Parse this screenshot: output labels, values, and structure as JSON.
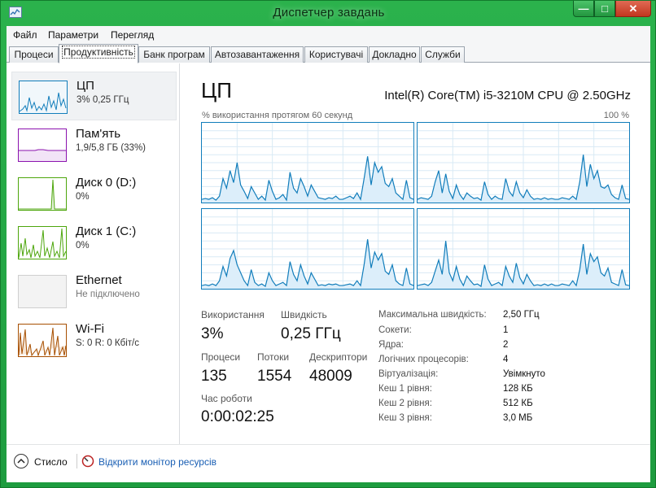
{
  "window": {
    "title": "Диспетчер завдань",
    "controls": {
      "minimize": "—",
      "maximize": "□",
      "close": "✕"
    }
  },
  "menu": [
    "Файл",
    "Параметри",
    "Перегляд"
  ],
  "tabs": [
    "Процеси",
    "Продуктивність",
    "Банк програм",
    "Автозавантаження",
    "Користувачі",
    "Докладно",
    "Служби"
  ],
  "active_tab": "Продуктивність",
  "sidebar": {
    "items": [
      {
        "name": "ЦП",
        "sub": "3% 0,25 ГГц",
        "color": "#117dbb"
      },
      {
        "name": "Пам'ять",
        "sub": "1,9/5,8 ГБ (33%)",
        "color": "#8b12ae"
      },
      {
        "name": "Диск 0 (D:)",
        "sub": "0%",
        "color": "#4da60c"
      },
      {
        "name": "Диск 1 (C:)",
        "sub": "0%",
        "color": "#4da60c"
      },
      {
        "name": "Ethernet",
        "sub": "Не підключено",
        "color": "#a7a7a7"
      },
      {
        "name": "Wi-Fi",
        "sub": "S: 0 R: 0 Кбіт/с",
        "color": "#a74f01"
      }
    ]
  },
  "cpu": {
    "title": "ЦП",
    "model": "Intel(R) Core(TM) i5-3210M CPU @ 2.50GHz",
    "graph_caption": "% використання протягом 60 секунд",
    "graph_max": "100 %",
    "stats": {
      "utilization_label": "Використання",
      "utilization": "3%",
      "speed_label": "Швидкість",
      "speed": "0,25 ГГц",
      "processes_label": "Процеси",
      "processes": "135",
      "threads_label": "Потоки",
      "threads": "1554",
      "handles_label": "Дескриптори",
      "handles": "48009",
      "uptime_label": "Час роботи",
      "uptime": "0:00:02:25"
    },
    "details": [
      {
        "label": "Максимальна швидкість:",
        "value": "2,50 ГГц"
      },
      {
        "label": "Сокети:",
        "value": "1"
      },
      {
        "label": "Ядра:",
        "value": "2"
      },
      {
        "label": "Логічних процесорів:",
        "value": "4"
      },
      {
        "label": "Віртуалізація:",
        "value": "Увімкнуто"
      },
      {
        "label": "Кеш 1 рівня:",
        "value": "128 КБ"
      },
      {
        "label": "Кеш 2 рівня:",
        "value": "512 КБ"
      },
      {
        "label": "Кеш 3 рівня:",
        "value": "3,0 МБ"
      }
    ],
    "core_graphs": [
      [
        4,
        5,
        4,
        6,
        3,
        8,
        30,
        18,
        40,
        25,
        50,
        22,
        14,
        5,
        20,
        12,
        4,
        8,
        3,
        28,
        14,
        4,
        6,
        10,
        3,
        38,
        18,
        12,
        30,
        20,
        8,
        22,
        14,
        6,
        5,
        4,
        6,
        5,
        8,
        4,
        4,
        6,
        8,
        5,
        12,
        4,
        30,
        58,
        22,
        50,
        38,
        45,
        24,
        20,
        30,
        12,
        8,
        4,
        28,
        6,
        4
      ],
      [
        4,
        6,
        5,
        4,
        8,
        26,
        40,
        12,
        36,
        14,
        5,
        22,
        10,
        4,
        12,
        8,
        5,
        6,
        3,
        26,
        10,
        4,
        8,
        5,
        4,
        30,
        14,
        8,
        26,
        12,
        6,
        16,
        8,
        4,
        5,
        4,
        6,
        4,
        5,
        4,
        4,
        6,
        5,
        4,
        8,
        4,
        26,
        60,
        20,
        48,
        30,
        40,
        20,
        18,
        22,
        10,
        6,
        4,
        22,
        5,
        4
      ],
      [
        4,
        5,
        4,
        6,
        4,
        10,
        28,
        16,
        38,
        48,
        30,
        20,
        10,
        4,
        24,
        8,
        4,
        6,
        3,
        20,
        10,
        4,
        6,
        8,
        4,
        34,
        18,
        10,
        30,
        16,
        6,
        20,
        12,
        4,
        5,
        4,
        6,
        5,
        6,
        4,
        4,
        5,
        6,
        4,
        10,
        4,
        30,
        62,
        26,
        46,
        36,
        44,
        22,
        18,
        30,
        10,
        6,
        4,
        26,
        6,
        4
      ],
      [
        4,
        5,
        6,
        4,
        8,
        22,
        36,
        18,
        60,
        20,
        10,
        28,
        12,
        4,
        16,
        10,
        5,
        6,
        3,
        30,
        12,
        4,
        6,
        8,
        4,
        28,
        16,
        8,
        32,
        14,
        6,
        18,
        10,
        4,
        5,
        4,
        6,
        4,
        6,
        4,
        4,
        6,
        5,
        4,
        10,
        4,
        24,
        56,
        18,
        44,
        34,
        40,
        20,
        16,
        26,
        8,
        6,
        4,
        24,
        5,
        4
      ]
    ]
  },
  "footer": {
    "fewer_details": "Стисло",
    "open_monitor": "Відкрити монітор ресурсів"
  }
}
